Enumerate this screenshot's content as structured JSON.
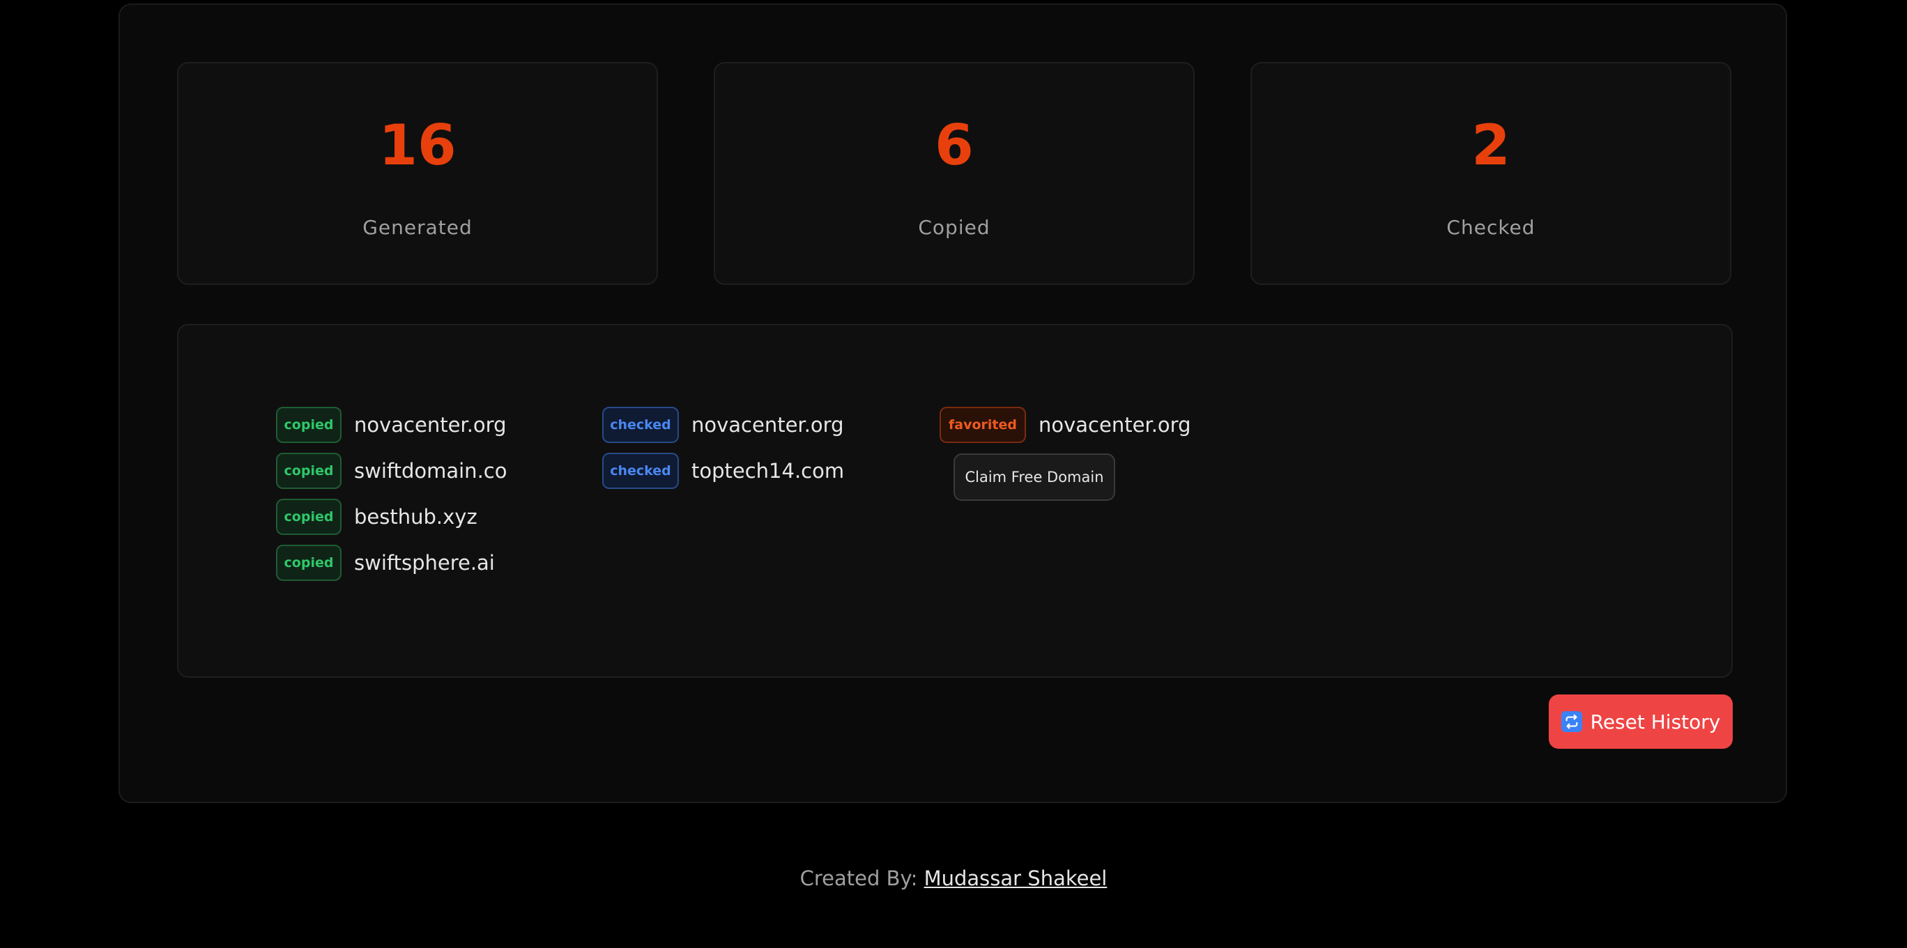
{
  "stats": [
    {
      "value": "16",
      "label": "Generated"
    },
    {
      "value": "6",
      "label": "Copied"
    },
    {
      "value": "2",
      "label": "Checked"
    }
  ],
  "history": {
    "copied": {
      "badge": "copied",
      "domains": [
        "novacenter.org",
        "swiftdomain.co",
        "besthub.xyz",
        "swiftsphere.ai"
      ]
    },
    "checked": {
      "badge": "checked",
      "domains": [
        "novacenter.org",
        "toptech14.com"
      ]
    },
    "favorited": {
      "badge": "favorited",
      "domains": [
        "novacenter.org"
      ]
    },
    "claim_label": "Claim Free Domain"
  },
  "reset": {
    "label": "Reset History",
    "icon": "repeat-icon"
  },
  "footer": {
    "prefix": "Created By:",
    "author": "Mudassar Shakeel"
  },
  "colors": {
    "accent": "#e8400c",
    "copied": "#2fc76a",
    "checked": "#4a88f0",
    "favorited": "#ef5a1f",
    "reset": "#ef4444"
  }
}
